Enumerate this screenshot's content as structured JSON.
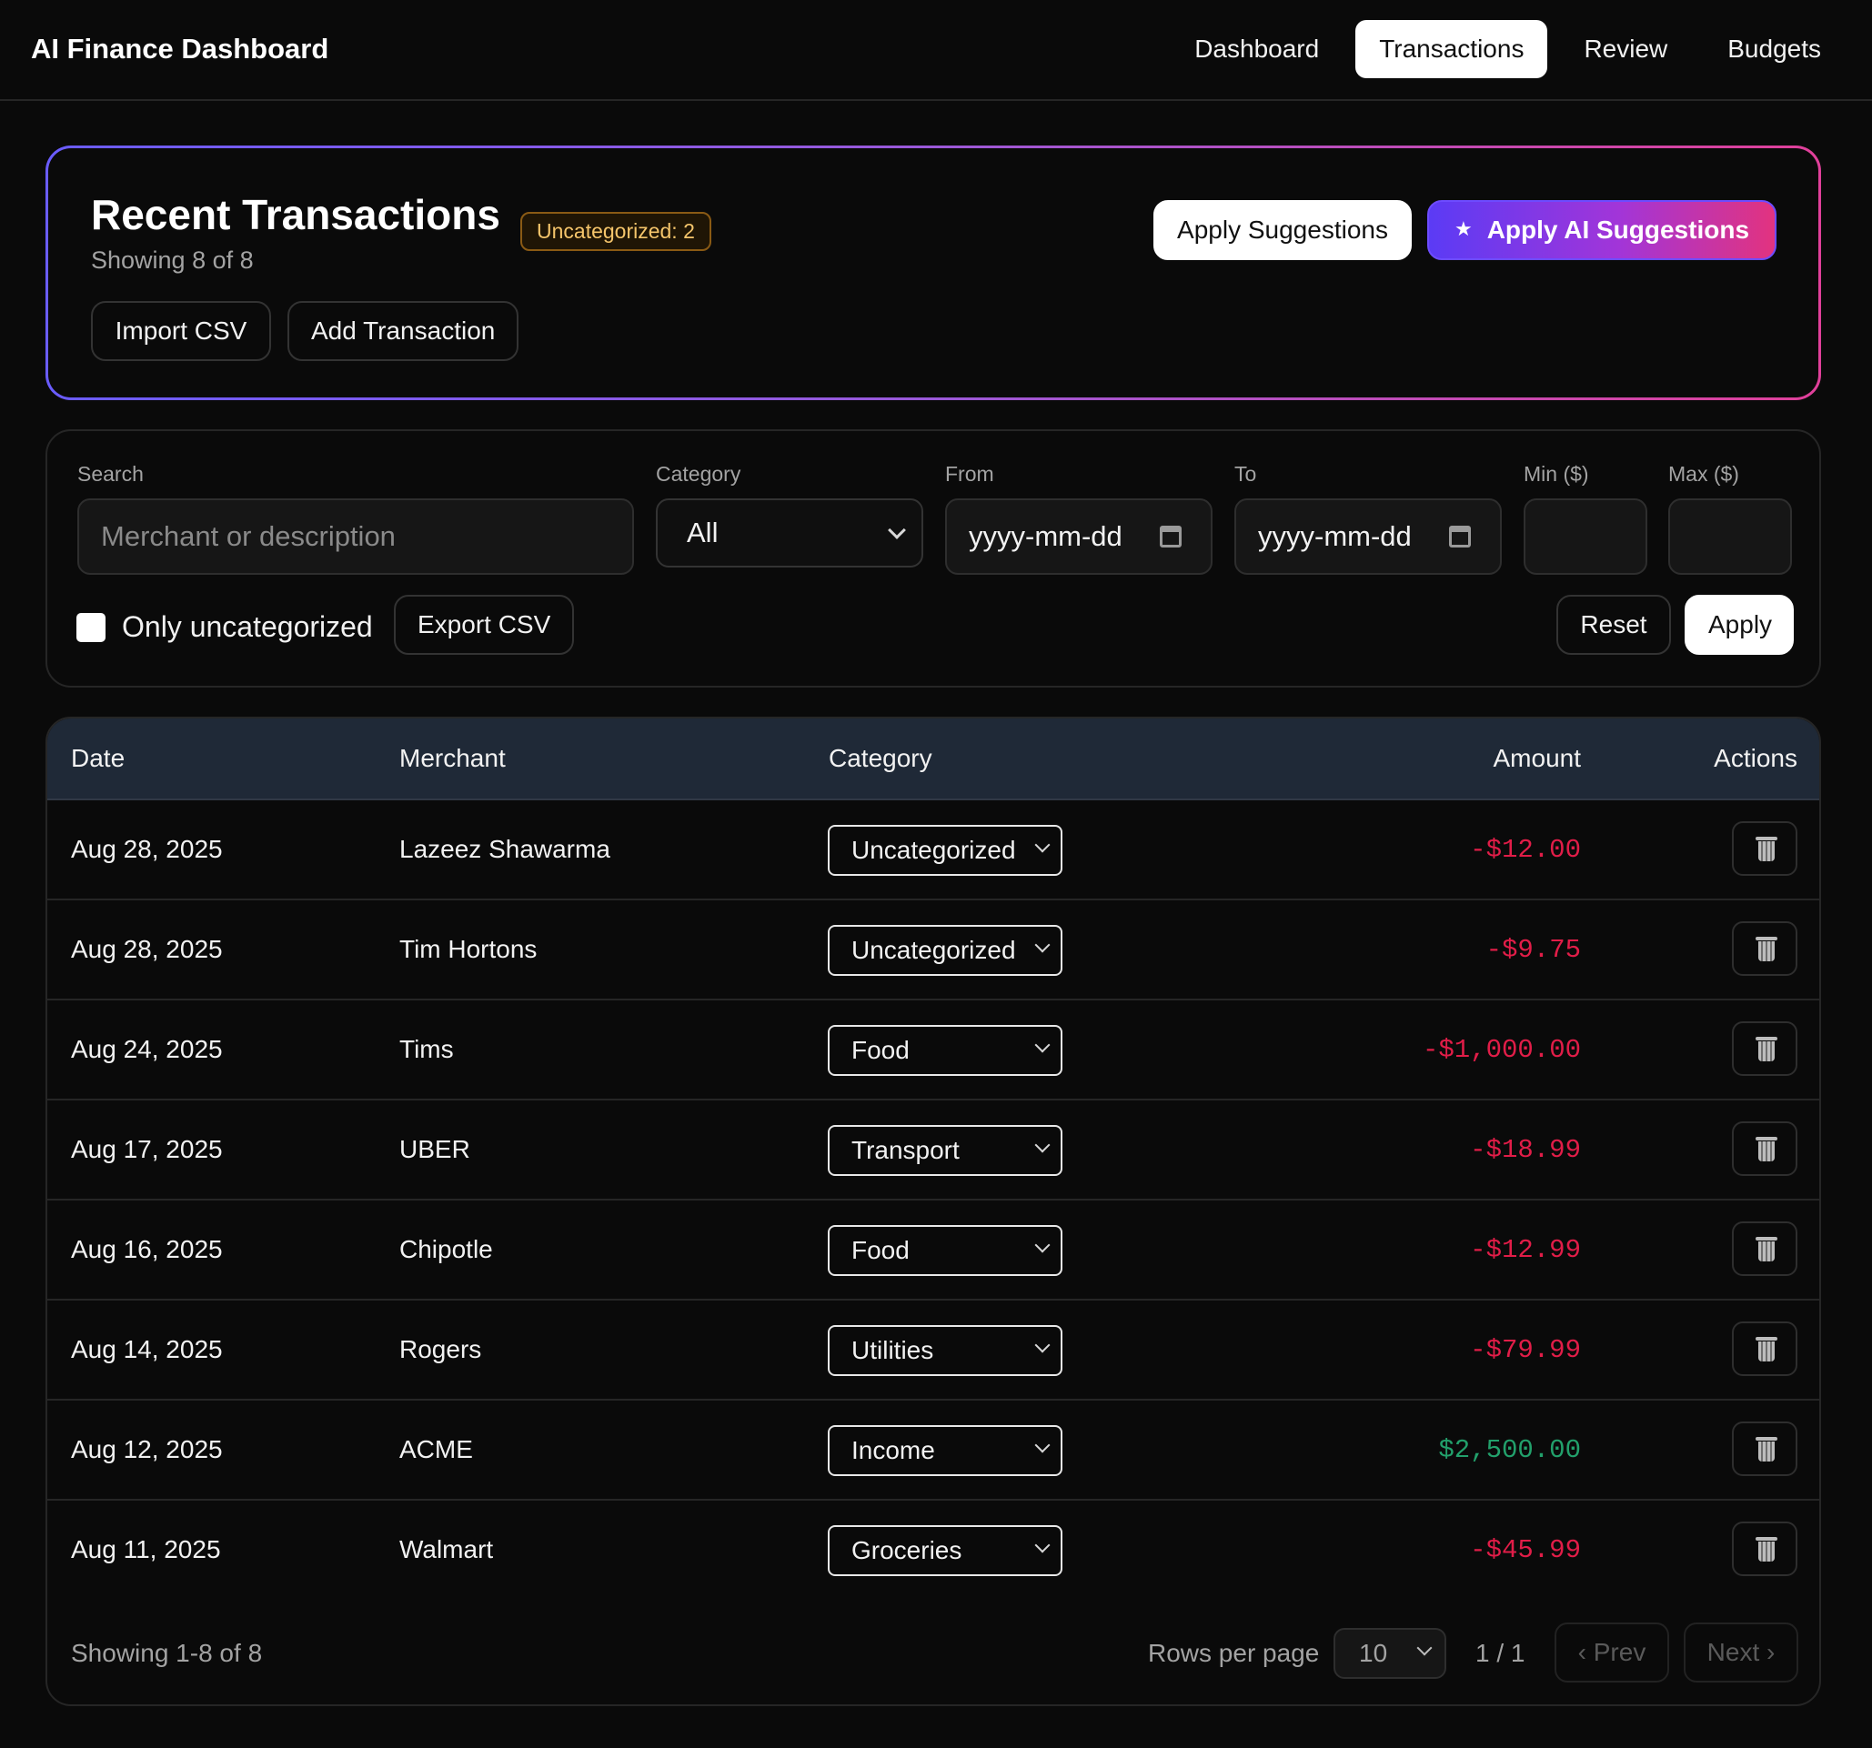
{
  "app": {
    "title": "AI Finance Dashboard"
  },
  "nav": [
    {
      "label": "Dashboard",
      "active": false
    },
    {
      "label": "Transactions",
      "active": true
    },
    {
      "label": "Review",
      "active": false
    },
    {
      "label": "Budgets",
      "active": false
    }
  ],
  "header": {
    "title": "Recent Transactions",
    "badge": "Uncategorized: 2",
    "subtitle": "Showing 8 of 8",
    "import_label": "Import CSV",
    "add_label": "Add Transaction",
    "apply_suggestions_label": "Apply Suggestions",
    "apply_ai_label": "Apply AI Suggestions",
    "ai_icon": "★"
  },
  "filters": {
    "search_label": "Search",
    "search_placeholder": "Merchant or description",
    "category_label": "Category",
    "category_value": "All",
    "from_label": "From",
    "from_placeholder": "yyyy-mm-dd",
    "to_label": "To",
    "to_placeholder": "yyyy-mm-dd",
    "min_label": "Min ($)",
    "max_label": "Max ($)",
    "only_uncategorized_label": "Only uncategorized",
    "only_uncategorized_checked": false,
    "export_label": "Export CSV",
    "reset_label": "Reset",
    "apply_label": "Apply"
  },
  "table": {
    "columns": [
      "Date",
      "Merchant",
      "Category",
      "Amount",
      "Actions"
    ],
    "rows": [
      {
        "date": "Aug 28, 2025",
        "merchant": "Lazeez Shawarma",
        "category": "Uncategorized",
        "amount": "-$12.00",
        "sign": "neg"
      },
      {
        "date": "Aug 28, 2025",
        "merchant": "Tim Hortons",
        "category": "Uncategorized",
        "amount": "-$9.75",
        "sign": "neg"
      },
      {
        "date": "Aug 24, 2025",
        "merchant": "Tims",
        "category": "Food",
        "amount": "-$1,000.00",
        "sign": "neg"
      },
      {
        "date": "Aug 17, 2025",
        "merchant": "UBER",
        "category": "Transport",
        "amount": "-$18.99",
        "sign": "neg"
      },
      {
        "date": "Aug 16, 2025",
        "merchant": "Chipotle",
        "category": "Food",
        "amount": "-$12.99",
        "sign": "neg"
      },
      {
        "date": "Aug 14, 2025",
        "merchant": "Rogers",
        "category": "Utilities",
        "amount": "-$79.99",
        "sign": "neg"
      },
      {
        "date": "Aug 12, 2025",
        "merchant": "ACME",
        "category": "Income",
        "amount": "$2,500.00",
        "sign": "pos"
      },
      {
        "date": "Aug 11, 2025",
        "merchant": "Walmart",
        "category": "Groceries",
        "amount": "-$45.99",
        "sign": "neg"
      }
    ],
    "row_action_icon": "trash-icon"
  },
  "pagination": {
    "summary": "Showing 1-8 of 8",
    "rows_per_page_label": "Rows per page",
    "rows_per_page": "10",
    "page_indicator": "1 / 1",
    "prev_label": "‹ Prev",
    "next_label": "Next ›"
  },
  "colors": {
    "background": "#0a0a0a",
    "negative": "#e11d48",
    "positive": "#22a06b",
    "accent_start": "#5b3bf5",
    "accent_end": "#e2337f",
    "badge_text": "#f5c56b"
  }
}
